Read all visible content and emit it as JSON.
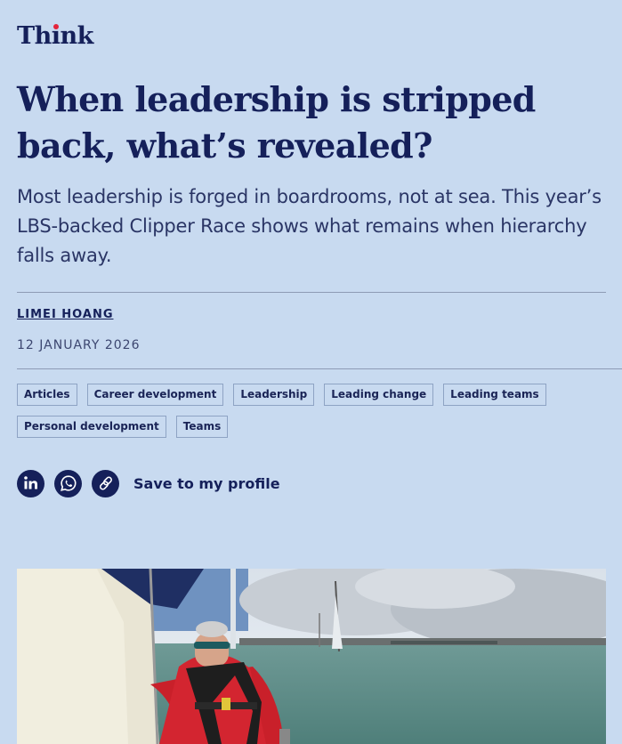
{
  "brand": {
    "logo_text_pre": "Th",
    "logo_text_i": "ı",
    "logo_text_post": "nk"
  },
  "article": {
    "headline": "When leadership is stripped back, what’s revealed?",
    "standfirst": "Most leadership is forged in boardrooms, not at sea. This year’s LBS-backed Clipper Race shows what remains when hierarchy falls away.",
    "author": "LIMEI HOANG",
    "date": "12 JANUARY 2026"
  },
  "tags": [
    "Articles",
    "Career development",
    "Leadership",
    "Leading change",
    "Leading teams",
    "Personal development",
    "Teams"
  ],
  "share": {
    "icons": [
      "linkedin-icon",
      "whatsapp-icon",
      "link-icon"
    ],
    "save_label": "Save to my profile"
  },
  "colors": {
    "background": "#c8daf0",
    "navy": "#15205a",
    "accent_red": "#e4243b"
  },
  "hero_image": {
    "alt": ""
  }
}
